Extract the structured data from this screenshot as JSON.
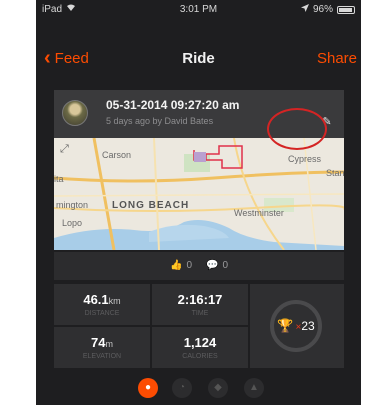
{
  "status_bar": {
    "device": "iPad",
    "wifi_icon": "wifi-icon",
    "time": "3:01 PM",
    "location_icon": "location-arrow-icon",
    "battery_percent": "96%",
    "battery_icon": "battery-icon"
  },
  "nav": {
    "back_label": "Feed",
    "title": "Ride",
    "share_label": "Share"
  },
  "activity": {
    "date": "05-31-2014 09:27:20 am",
    "subtitle": "5 days ago by David Bates",
    "edit_icon": "pencil-icon"
  },
  "map": {
    "labels": {
      "carson": "Carson",
      "cypress": "Cypress",
      "stan": "Stan",
      "mington": "mington",
      "long_beach": "LONG BEACH",
      "westminster": "Westminster",
      "lopo": "Lopo",
      "ita": "ita"
    }
  },
  "social": {
    "kudos_count": "0",
    "comments_count": "0"
  },
  "stats": {
    "distance_value": "46.1",
    "distance_unit": "km",
    "distance_label": "DISTANCE",
    "time_value": "2:16:17",
    "time_label": "TIME",
    "elevation_value": "74",
    "elevation_unit": "m",
    "elevation_label": "ELEVATION",
    "calories_value": "1,124",
    "calories_label": "CALORIES",
    "achievements_count": "23",
    "achievements_prefix": "×"
  },
  "colors": {
    "accent": "#fc4c02",
    "background": "#1e1e20",
    "card": "#3a3a3c",
    "highlight": "#d42424"
  }
}
